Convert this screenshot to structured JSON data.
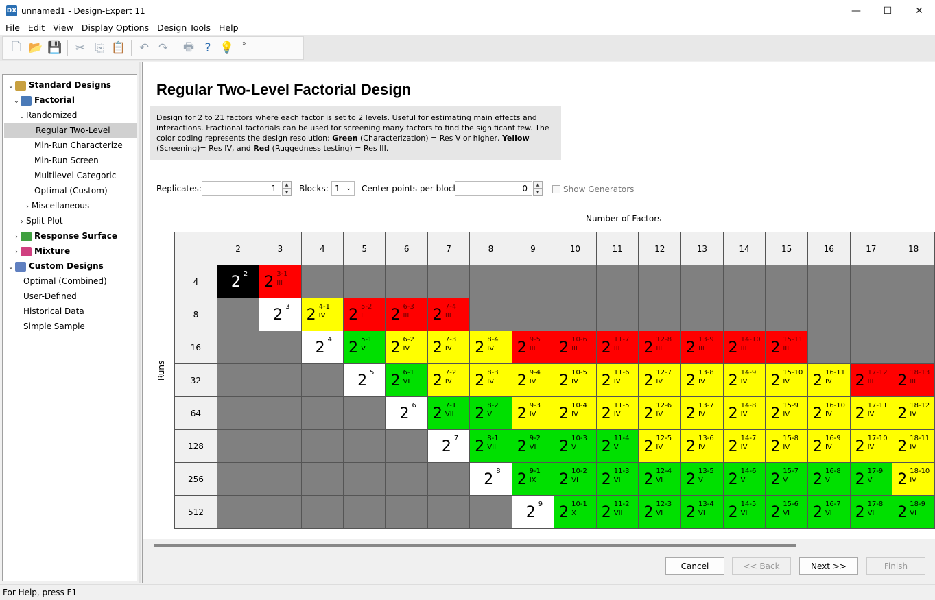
{
  "window": {
    "title": "unnamed1 - Design-Expert 11",
    "app_icon": "DX",
    "minimize": "—",
    "maximize": "☐",
    "close": "✕"
  },
  "menu": [
    "File",
    "Edit",
    "View",
    "Display Options",
    "Design Tools",
    "Help"
  ],
  "toolbar": {
    "items": [
      {
        "name": "new-icon",
        "glyph": "🗋"
      },
      {
        "name": "open-icon",
        "glyph": "📂"
      },
      {
        "name": "save-icon",
        "glyph": "💾"
      },
      {
        "name": "cut-icon",
        "glyph": "✂"
      },
      {
        "name": "copy-icon",
        "glyph": "⎘"
      },
      {
        "name": "paste-icon",
        "glyph": "📋"
      },
      {
        "name": "undo-icon",
        "glyph": "↶"
      },
      {
        "name": "redo-icon",
        "glyph": "↷"
      },
      {
        "name": "print-icon",
        "glyph": "🖶"
      },
      {
        "name": "help-icon",
        "glyph": "?"
      },
      {
        "name": "tip-bulb-icon",
        "glyph": "💡"
      }
    ],
    "more": "»"
  },
  "tree": [
    {
      "label": "Standard Designs",
      "bold": true,
      "caret": "⌄",
      "icon": "#c8a040",
      "selected": false
    },
    {
      "label": "Factorial",
      "bold": true,
      "caret": "⌄",
      "icon": "#4a7ab8",
      "selected": false
    },
    {
      "label": "Randomized",
      "bold": false,
      "caret": "⌄",
      "icon": "",
      "selected": false
    },
    {
      "label": "Regular Two-Level",
      "bold": false,
      "caret": "",
      "icon": "",
      "selected": true
    },
    {
      "label": "Min-Run Characterize",
      "bold": false,
      "caret": "",
      "icon": "",
      "selected": false
    },
    {
      "label": "Min-Run Screen",
      "bold": false,
      "caret": "",
      "icon": "",
      "selected": false
    },
    {
      "label": "Multilevel Categoric",
      "bold": false,
      "caret": "",
      "icon": "",
      "selected": false
    },
    {
      "label": "Optimal (Custom)",
      "bold": false,
      "caret": "",
      "icon": "",
      "selected": false
    },
    {
      "label": "Miscellaneous",
      "bold": false,
      "caret": "›",
      "icon": "",
      "selected": false
    },
    {
      "label": "Split-Plot",
      "bold": false,
      "caret": "›",
      "icon": "",
      "selected": false
    },
    {
      "label": "Response Surface",
      "bold": true,
      "caret": "›",
      "icon": "#40a040",
      "selected": false
    },
    {
      "label": "Mixture",
      "bold": true,
      "caret": "›",
      "icon": "#d04080",
      "selected": false
    },
    {
      "label": "Custom Designs",
      "bold": true,
      "caret": "⌄",
      "icon": "#6080c0",
      "selected": false
    },
    {
      "label": "Optimal (Combined)",
      "bold": false,
      "caret": "",
      "icon": "",
      "selected": false
    },
    {
      "label": "User-Defined",
      "bold": false,
      "caret": "",
      "icon": "",
      "selected": false
    },
    {
      "label": "Historical Data",
      "bold": false,
      "caret": "",
      "icon": "",
      "selected": false
    },
    {
      "label": "Simple Sample",
      "bold": false,
      "caret": "",
      "icon": "",
      "selected": false
    }
  ],
  "main": {
    "title": "Regular Two-Level Factorial Design",
    "description": {
      "part1": "Design for 2 to 21 factors where each factor is set to 2 levels. Useful for estimating main effects and interactions. Fractional factorials can be used for screening many factors to find the significant few. The color coding represents the design resolution: ",
      "green": "Green",
      "part2": " (Characterization) = Res V or higher, ",
      "yellow": "Yellow",
      "part3": " (Screening)= Res IV, and ",
      "red": "Red",
      "part4": " (Ruggedness testing) = Res III."
    },
    "replicates_label": "Replicates:",
    "replicates_value": "1",
    "blocks_label": "Blocks:",
    "blocks_value": "1",
    "center_points_label": "Center points per block:",
    "center_points_value": "0",
    "show_generators_label": "Show Generators",
    "show_generators_checked": false,
    "factors_label": "Number of Factors",
    "runs_label": "Runs",
    "factors": [
      "2",
      "3",
      "4",
      "5",
      "6",
      "7",
      "8",
      "9",
      "10",
      "11",
      "12",
      "13",
      "14",
      "15",
      "16",
      "17",
      "18"
    ],
    "runs": [
      "4",
      "8",
      "16",
      "32",
      "64",
      "128",
      "256",
      "512"
    ],
    "colors": {
      "full": "#ffffff",
      "fullest": "#000000",
      "res_iii": "#ff0000",
      "res_iv": "#ffff00",
      "res_v_plus": "#00e000",
      "na": "#808080"
    },
    "grid": [
      [
        {
          "c": "black",
          "b": "2",
          "e": "2",
          "r": ""
        },
        {
          "c": "red",
          "b": "2",
          "e": "3-1",
          "r": "III"
        },
        {
          "c": "gray"
        },
        {
          "c": "gray"
        },
        {
          "c": "gray"
        },
        {
          "c": "gray"
        },
        {
          "c": "gray"
        },
        {
          "c": "gray"
        },
        {
          "c": "gray"
        },
        {
          "c": "gray"
        },
        {
          "c": "gray"
        },
        {
          "c": "gray"
        },
        {
          "c": "gray"
        },
        {
          "c": "gray"
        },
        {
          "c": "gray"
        },
        {
          "c": "gray"
        },
        {
          "c": "gray"
        }
      ],
      [
        {
          "c": "gray"
        },
        {
          "c": "white",
          "b": "2",
          "e": "3",
          "r": ""
        },
        {
          "c": "yellow",
          "b": "2",
          "e": "4-1",
          "r": "IV"
        },
        {
          "c": "red",
          "b": "2",
          "e": "5-2",
          "r": "III"
        },
        {
          "c": "red",
          "b": "2",
          "e": "6-3",
          "r": "III"
        },
        {
          "c": "red",
          "b": "2",
          "e": "7-4",
          "r": "III"
        },
        {
          "c": "gray"
        },
        {
          "c": "gray"
        },
        {
          "c": "gray"
        },
        {
          "c": "gray"
        },
        {
          "c": "gray"
        },
        {
          "c": "gray"
        },
        {
          "c": "gray"
        },
        {
          "c": "gray"
        },
        {
          "c": "gray"
        },
        {
          "c": "gray"
        },
        {
          "c": "gray"
        }
      ],
      [
        {
          "c": "gray"
        },
        {
          "c": "gray"
        },
        {
          "c": "white",
          "b": "2",
          "e": "4",
          "r": ""
        },
        {
          "c": "green",
          "b": "2",
          "e": "5-1",
          "r": "V"
        },
        {
          "c": "yellow",
          "b": "2",
          "e": "6-2",
          "r": "IV"
        },
        {
          "c": "yellow",
          "b": "2",
          "e": "7-3",
          "r": "IV"
        },
        {
          "c": "yellow",
          "b": "2",
          "e": "8-4",
          "r": "IV"
        },
        {
          "c": "red",
          "b": "2",
          "e": "9-5",
          "r": "III"
        },
        {
          "c": "red",
          "b": "2",
          "e": "10-6",
          "r": "III"
        },
        {
          "c": "red",
          "b": "2",
          "e": "11-7",
          "r": "III"
        },
        {
          "c": "red",
          "b": "2",
          "e": "12-8",
          "r": "III"
        },
        {
          "c": "red",
          "b": "2",
          "e": "13-9",
          "r": "III"
        },
        {
          "c": "red",
          "b": "2",
          "e": "14-10",
          "r": "III"
        },
        {
          "c": "red",
          "b": "2",
          "e": "15-11",
          "r": "III"
        },
        {
          "c": "gray"
        },
        {
          "c": "gray"
        },
        {
          "c": "gray"
        }
      ],
      [
        {
          "c": "gray"
        },
        {
          "c": "gray"
        },
        {
          "c": "gray"
        },
        {
          "c": "white",
          "b": "2",
          "e": "5",
          "r": ""
        },
        {
          "c": "green",
          "b": "2",
          "e": "6-1",
          "r": "VI"
        },
        {
          "c": "yellow",
          "b": "2",
          "e": "7-2",
          "r": "IV"
        },
        {
          "c": "yellow",
          "b": "2",
          "e": "8-3",
          "r": "IV"
        },
        {
          "c": "yellow",
          "b": "2",
          "e": "9-4",
          "r": "IV"
        },
        {
          "c": "yellow",
          "b": "2",
          "e": "10-5",
          "r": "IV"
        },
        {
          "c": "yellow",
          "b": "2",
          "e": "11-6",
          "r": "IV"
        },
        {
          "c": "yellow",
          "b": "2",
          "e": "12-7",
          "r": "IV"
        },
        {
          "c": "yellow",
          "b": "2",
          "e": "13-8",
          "r": "IV"
        },
        {
          "c": "yellow",
          "b": "2",
          "e": "14-9",
          "r": "IV"
        },
        {
          "c": "yellow",
          "b": "2",
          "e": "15-10",
          "r": "IV"
        },
        {
          "c": "yellow",
          "b": "2",
          "e": "16-11",
          "r": "IV"
        },
        {
          "c": "red",
          "b": "2",
          "e": "17-12",
          "r": "III"
        },
        {
          "c": "red",
          "b": "2",
          "e": "18-13",
          "r": "III"
        }
      ],
      [
        {
          "c": "gray"
        },
        {
          "c": "gray"
        },
        {
          "c": "gray"
        },
        {
          "c": "gray"
        },
        {
          "c": "white",
          "b": "2",
          "e": "6",
          "r": ""
        },
        {
          "c": "green",
          "b": "2",
          "e": "7-1",
          "r": "VII"
        },
        {
          "c": "green",
          "b": "2",
          "e": "8-2",
          "r": "V"
        },
        {
          "c": "yellow",
          "b": "2",
          "e": "9-3",
          "r": "IV"
        },
        {
          "c": "yellow",
          "b": "2",
          "e": "10-4",
          "r": "IV"
        },
        {
          "c": "yellow",
          "b": "2",
          "e": "11-5",
          "r": "IV"
        },
        {
          "c": "yellow",
          "b": "2",
          "e": "12-6",
          "r": "IV"
        },
        {
          "c": "yellow",
          "b": "2",
          "e": "13-7",
          "r": "IV"
        },
        {
          "c": "yellow",
          "b": "2",
          "e": "14-8",
          "r": "IV"
        },
        {
          "c": "yellow",
          "b": "2",
          "e": "15-9",
          "r": "IV"
        },
        {
          "c": "yellow",
          "b": "2",
          "e": "16-10",
          "r": "IV"
        },
        {
          "c": "yellow",
          "b": "2",
          "e": "17-11",
          "r": "IV"
        },
        {
          "c": "yellow",
          "b": "2",
          "e": "18-12",
          "r": "IV"
        }
      ],
      [
        {
          "c": "gray"
        },
        {
          "c": "gray"
        },
        {
          "c": "gray"
        },
        {
          "c": "gray"
        },
        {
          "c": "gray"
        },
        {
          "c": "white",
          "b": "2",
          "e": "7",
          "r": ""
        },
        {
          "c": "green",
          "b": "2",
          "e": "8-1",
          "r": "VIII"
        },
        {
          "c": "green",
          "b": "2",
          "e": "9-2",
          "r": "VI"
        },
        {
          "c": "green",
          "b": "2",
          "e": "10-3",
          "r": "V"
        },
        {
          "c": "green",
          "b": "2",
          "e": "11-4",
          "r": "V"
        },
        {
          "c": "yellow",
          "b": "2",
          "e": "12-5",
          "r": "IV"
        },
        {
          "c": "yellow",
          "b": "2",
          "e": "13-6",
          "r": "IV"
        },
        {
          "c": "yellow",
          "b": "2",
          "e": "14-7",
          "r": "IV"
        },
        {
          "c": "yellow",
          "b": "2",
          "e": "15-8",
          "r": "IV"
        },
        {
          "c": "yellow",
          "b": "2",
          "e": "16-9",
          "r": "IV"
        },
        {
          "c": "yellow",
          "b": "2",
          "e": "17-10",
          "r": "IV"
        },
        {
          "c": "yellow",
          "b": "2",
          "e": "18-11",
          "r": "IV"
        }
      ],
      [
        {
          "c": "gray"
        },
        {
          "c": "gray"
        },
        {
          "c": "gray"
        },
        {
          "c": "gray"
        },
        {
          "c": "gray"
        },
        {
          "c": "gray"
        },
        {
          "c": "white",
          "b": "2",
          "e": "8",
          "r": ""
        },
        {
          "c": "green",
          "b": "2",
          "e": "9-1",
          "r": "IX"
        },
        {
          "c": "green",
          "b": "2",
          "e": "10-2",
          "r": "VI"
        },
        {
          "c": "green",
          "b": "2",
          "e": "11-3",
          "r": "VI"
        },
        {
          "c": "green",
          "b": "2",
          "e": "12-4",
          "r": "VI"
        },
        {
          "c": "green",
          "b": "2",
          "e": "13-5",
          "r": "V"
        },
        {
          "c": "green",
          "b": "2",
          "e": "14-6",
          "r": "V"
        },
        {
          "c": "green",
          "b": "2",
          "e": "15-7",
          "r": "V"
        },
        {
          "c": "green",
          "b": "2",
          "e": "16-8",
          "r": "V"
        },
        {
          "c": "green",
          "b": "2",
          "e": "17-9",
          "r": "V"
        },
        {
          "c": "yellow",
          "b": "2",
          "e": "18-10",
          "r": "IV"
        }
      ],
      [
        {
          "c": "gray"
        },
        {
          "c": "gray"
        },
        {
          "c": "gray"
        },
        {
          "c": "gray"
        },
        {
          "c": "gray"
        },
        {
          "c": "gray"
        },
        {
          "c": "gray"
        },
        {
          "c": "white",
          "b": "2",
          "e": "9",
          "r": ""
        },
        {
          "c": "green",
          "b": "2",
          "e": "10-1",
          "r": "X"
        },
        {
          "c": "green",
          "b": "2",
          "e": "11-2",
          "r": "VII"
        },
        {
          "c": "green",
          "b": "2",
          "e": "12-3",
          "r": "VI"
        },
        {
          "c": "green",
          "b": "2",
          "e": "13-4",
          "r": "VI"
        },
        {
          "c": "green",
          "b": "2",
          "e": "14-5",
          "r": "VI"
        },
        {
          "c": "green",
          "b": "2",
          "e": "15-6",
          "r": "VI"
        },
        {
          "c": "green",
          "b": "2",
          "e": "16-7",
          "r": "VI"
        },
        {
          "c": "green",
          "b": "2",
          "e": "17-8",
          "r": "VI"
        },
        {
          "c": "green",
          "b": "2",
          "e": "18-9",
          "r": "VI"
        }
      ]
    ]
  },
  "buttons": {
    "cancel": "Cancel",
    "back": "<< Back",
    "next": "Next >>",
    "finish": "Finish"
  },
  "status": "For Help, press F1"
}
